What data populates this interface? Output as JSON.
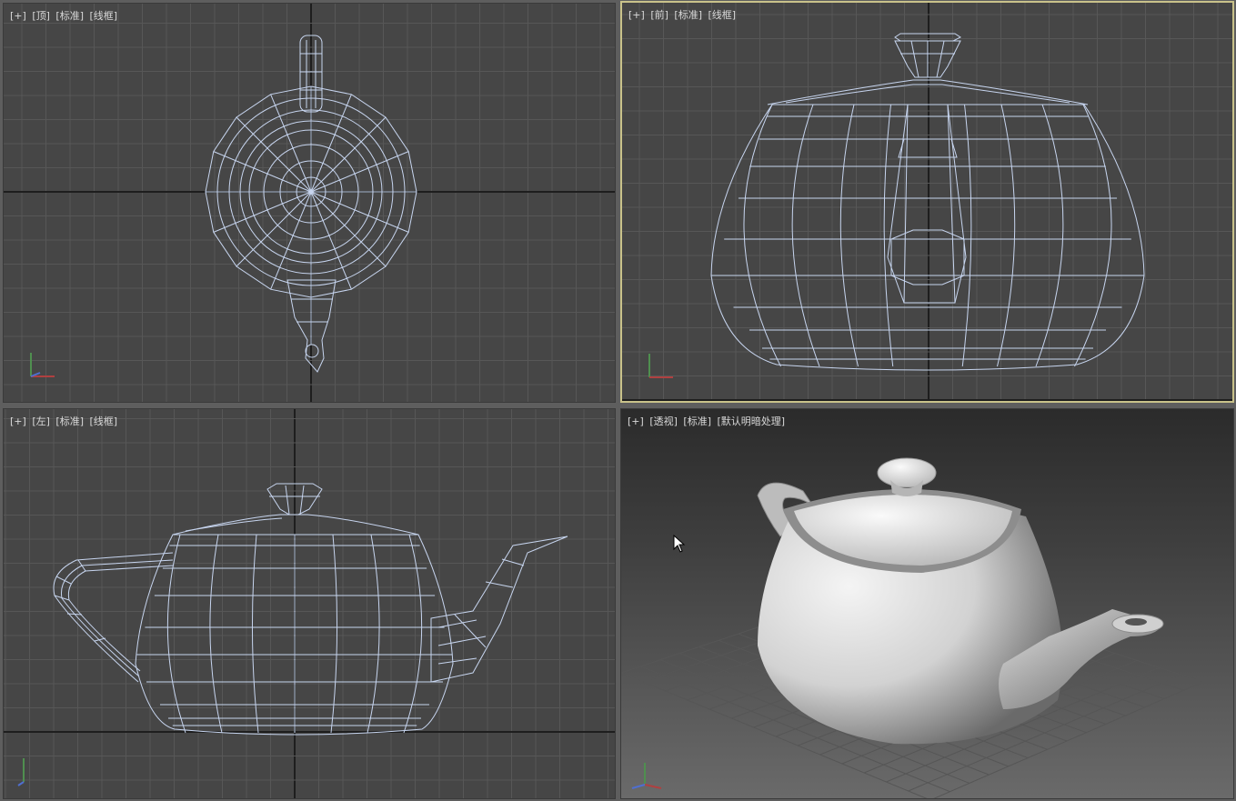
{
  "viewports": {
    "top": {
      "plus": "[+]",
      "view": "[顶]",
      "shading": "[标准]",
      "mode": "[线框]"
    },
    "front": {
      "plus": "[+]",
      "view": "[前]",
      "shading": "[标准]",
      "mode": "[线框]"
    },
    "left": {
      "plus": "[+]",
      "view": "[左]",
      "shading": "[标准]",
      "mode": "[线框]"
    },
    "perspective": {
      "plus": "[+]",
      "view": "[透视]",
      "shading": "[标准]",
      "mode": "[默认明暗处理]"
    }
  },
  "colors": {
    "viewport_bg": "#464646",
    "grid_line": "#575757",
    "grid_axis": "#1e1e1e",
    "wireframe": "#c7d5ef",
    "active_border": "#c9c28a"
  },
  "icons": {
    "axis_gizmo": "xyz-axis-icon",
    "mouse_cursor": "arrow-cursor-icon"
  }
}
